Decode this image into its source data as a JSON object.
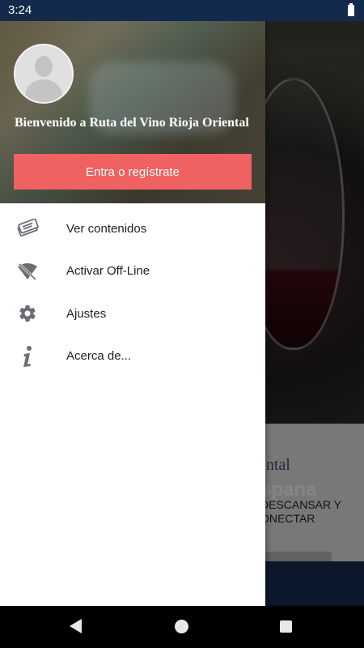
{
  "status_bar": {
    "time": "3:24"
  },
  "background": {
    "title_fragment": "ental",
    "logo_fragment": "spana",
    "promo_text": "DESCANSAR Y\nONECTAR"
  },
  "drawer": {
    "welcome_text": "Bienvenido a Ruta del Vino Rioja Oriental",
    "login_button": "Entra o regístrate",
    "items": [
      {
        "label": "Ver contenidos",
        "icon": "tickets-icon"
      },
      {
        "label": "Activar Off-Line",
        "icon": "wifi-off-icon"
      },
      {
        "label": "Ajustes",
        "icon": "gear-icon"
      },
      {
        "label": "Acerca de...",
        "icon": "info-icon"
      }
    ]
  },
  "colors": {
    "accent": "#f06161",
    "status_bar": "#132a4d",
    "icon": "#6b6f73"
  }
}
